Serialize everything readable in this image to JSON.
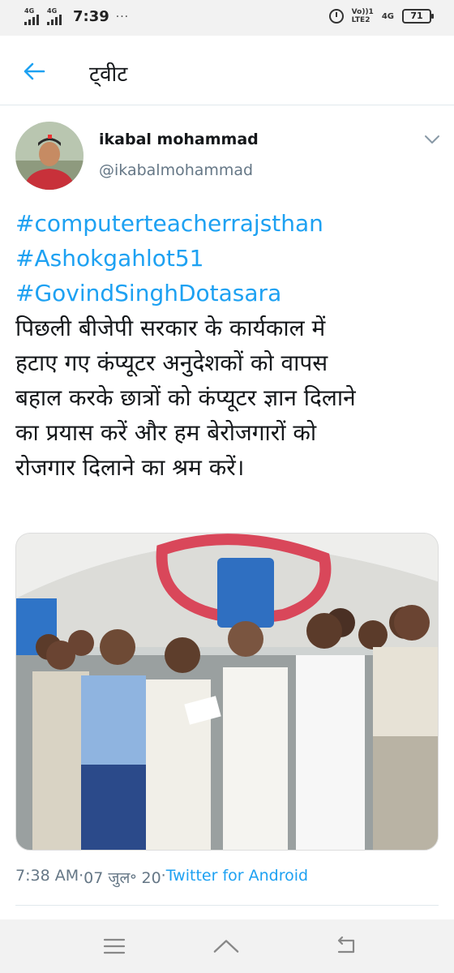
{
  "status_bar": {
    "time": "7:39",
    "dots": "···",
    "network1": "4G",
    "network2": "4G",
    "volte_line1": "Vo))1",
    "volte_line2": "LTE2",
    "mobile_net": "4G",
    "battery": "71"
  },
  "header": {
    "title": "ट्वीट"
  },
  "tweet": {
    "user_name": "ikabal mohammad",
    "user_handle": "@ikabalmohammad",
    "hashtags": [
      "#computerteacherrajsthan",
      "#Ashokgahlot51",
      "#GovindSinghDotasara"
    ],
    "body_lines": [
      "पिछली बीजेपी सरकार के कार्यकाल में",
      "हटाए गए कंप्यूटर अनुदेशकों को वापस",
      "बहाल करके छात्रों को कंप्यूटर ज्ञान दिलाने",
      "का प्रयास करें और हम बेरोजगारों को",
      "रोजगार दिलाने का श्रम करें।"
    ],
    "time": "7:38 AM",
    "date": "07 जुल॰ 20",
    "separator": " · ",
    "source": "Twitter for Android"
  },
  "icons": {
    "back": "arrow-left-icon",
    "caret": "chevron-down-icon",
    "recents": "menu-icon",
    "home": "home-icon",
    "back_nav": "return-icon"
  },
  "colors": {
    "accent": "#1da1f2",
    "text": "#14171a",
    "secondary": "#657786"
  }
}
